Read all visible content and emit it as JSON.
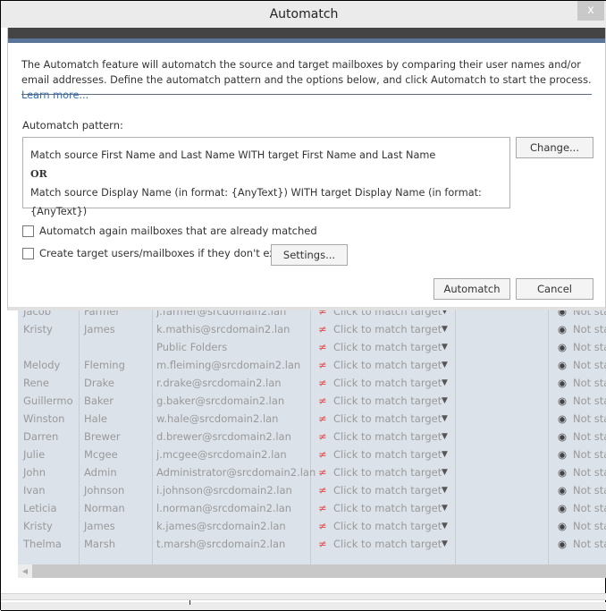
{
  "window": {
    "title": "Automatch",
    "close_icon": "x"
  },
  "dialog": {
    "description": "The Automatch feature will automatch the source and target mailboxes by comparing their user names and/or email addresses. Define the automatch pattern and the options below, and click Automatch to start the process.",
    "learn_more": "Learn more...",
    "pattern_label": "Automatch pattern:",
    "pattern_line1": "Match source First Name and Last Name WITH target First Name and Last Name",
    "pattern_or": "OR",
    "pattern_line2": "Match source Display Name (in format: {AnyText}) WITH target Display Name (in format: {AnyText})",
    "change_button": "Change...",
    "option1": {
      "label": "Automatch again mailboxes that are already matched",
      "checked": false
    },
    "option2": {
      "label": "Create target users/mailboxes if they don't exist",
      "checked": false
    },
    "settings_button": "Settings...",
    "automatch_button": "Automatch",
    "cancel_button": "Cancel"
  },
  "grid": {
    "match_text": "Click to match target",
    "not_equal_symbol": "≠",
    "status_text": "Not sta",
    "rows": [
      {
        "first": "Jacob",
        "last": "Farmer",
        "email": "j.farmer@srcdomain2.lan"
      },
      {
        "first": "Kristy",
        "last": "James",
        "email": "k.mathis@srcdomain2.lan"
      },
      {
        "first": "",
        "last": "",
        "email": "Public Folders"
      },
      {
        "first": "Melody",
        "last": "Fleming",
        "email": "m.fleiming@srcdomain2.lan"
      },
      {
        "first": "Rene",
        "last": "Drake",
        "email": "r.drake@srcdomain2.lan"
      },
      {
        "first": "Guillermo",
        "last": "Baker",
        "email": "g.baker@srcdomain2.lan"
      },
      {
        "first": "Winston",
        "last": "Hale",
        "email": "w.hale@srcdomain2.lan"
      },
      {
        "first": "Darren",
        "last": "Brewer",
        "email": "d.brewer@srcdomain2.lan"
      },
      {
        "first": "Julie",
        "last": "Mcgee",
        "email": "j.mcgee@srcdomain2.lan"
      },
      {
        "first": "John",
        "last": "Admin",
        "email": "Administrator@srcdomain2.lan"
      },
      {
        "first": "Ivan",
        "last": "Johnson",
        "email": "i.johnson@srcdomain2.lan"
      },
      {
        "first": "Leticia",
        "last": "Norman",
        "email": "l.norman@srcdomain2.lan"
      },
      {
        "first": "Kristy",
        "last": "James",
        "email": "k.james@srcdomain2.lan"
      },
      {
        "first": "Thelma",
        "last": "Marsh",
        "email": "t.marsh@srcdomain2.lan"
      }
    ]
  }
}
